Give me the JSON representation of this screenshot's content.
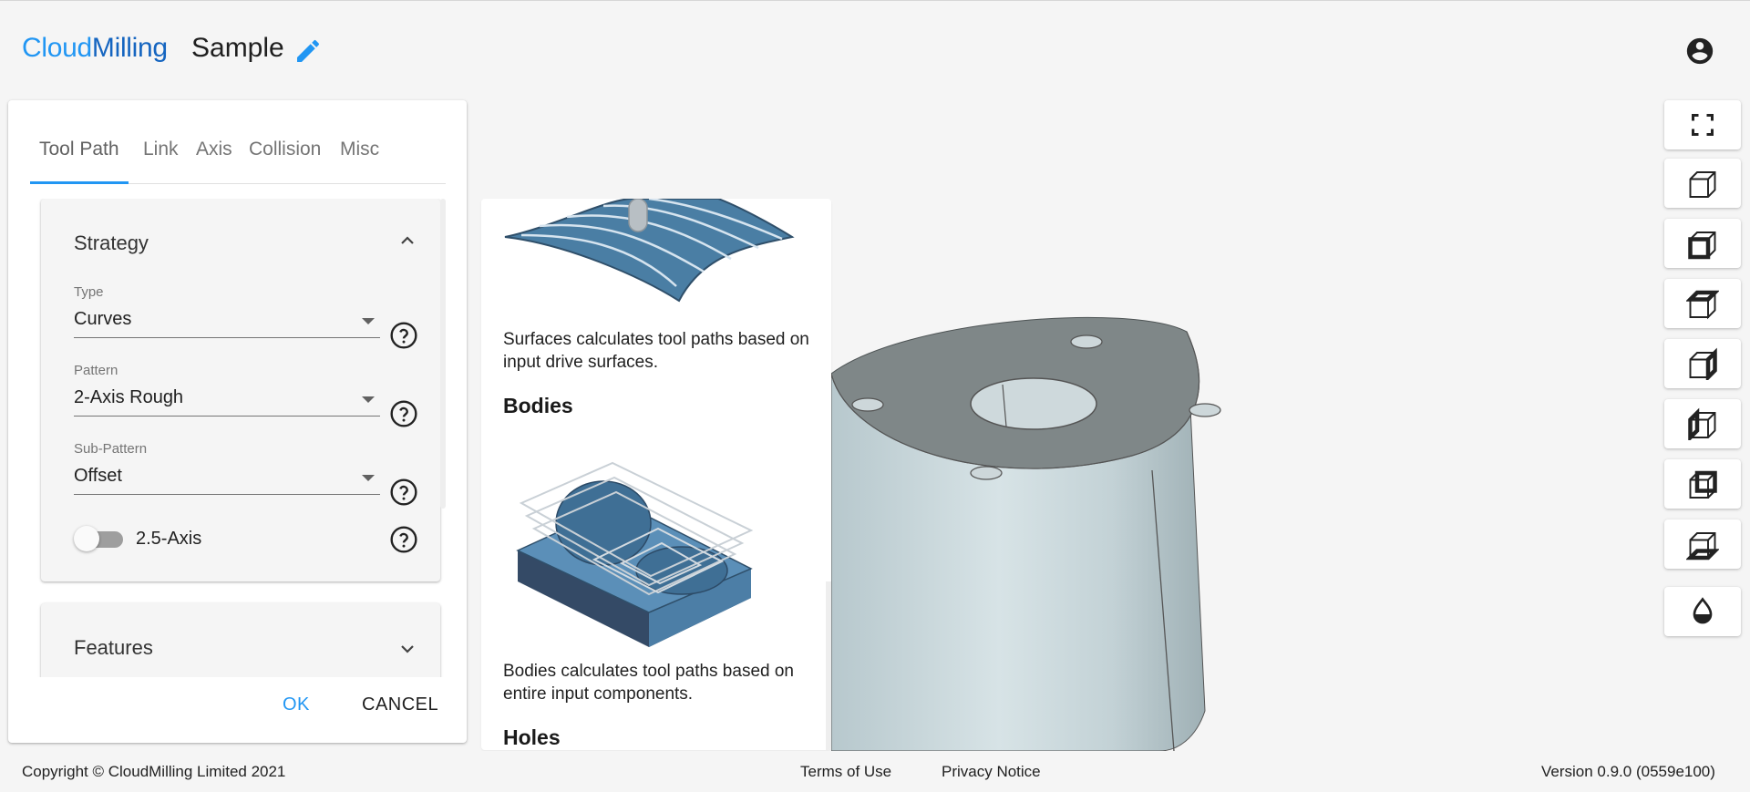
{
  "header": {
    "brand_part1": "Cloud",
    "brand_part2": "Milling",
    "project_name": "Sample"
  },
  "tabs": [
    "Tool Path",
    "Link",
    "Axis",
    "Collision",
    "Misc"
  ],
  "strategy": {
    "title": "Strategy",
    "type": {
      "label": "Type",
      "value": "Curves"
    },
    "pattern": {
      "label": "Pattern",
      "value": "2-Axis Rough"
    },
    "sub_pattern": {
      "label": "Sub-Pattern",
      "value": "Offset"
    },
    "toggle": {
      "label": "2.5-Axis",
      "on": false
    }
  },
  "features": {
    "title": "Features"
  },
  "actions": {
    "ok": "OK",
    "cancel": "CANCEL"
  },
  "info": {
    "surfaces_text": "Surfaces calculates tool paths based on input drive surfaces.",
    "bodies_heading": "Bodies",
    "bodies_text": "Bodies calculates tool paths based on entire input components.",
    "holes_heading": "Holes"
  },
  "view_buttons": [
    "fullscreen-icon",
    "view-cube-iso-icon",
    "view-cube-front-icon",
    "view-cube-top-icon",
    "view-cube-right-icon",
    "view-cube-left-icon",
    "view-cube-back-icon",
    "view-cube-bottom-icon",
    "render-mode-icon"
  ],
  "footer": {
    "copyright": "Copyright © CloudMilling Limited 2021",
    "terms": "Terms of Use",
    "privacy": "Privacy Notice",
    "version": "Version 0.9.0 (0559e100)"
  },
  "colors": {
    "accent": "#2196f3",
    "brand_dark": "#1565c0",
    "model_top": "#7f8788",
    "model_side": "#c8d6da"
  }
}
